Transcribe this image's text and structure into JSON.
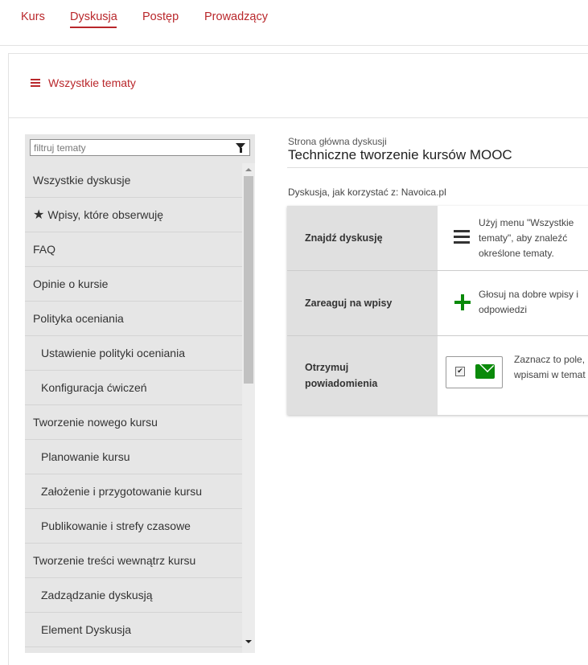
{
  "nav": {
    "tabs": [
      {
        "label": "Kurs"
      },
      {
        "label": "Dyskusja",
        "active": true
      },
      {
        "label": "Postęp"
      },
      {
        "label": "Prowadzący"
      }
    ]
  },
  "all_topics": {
    "label": "Wszystkie tematy",
    "icon": "menu-icon"
  },
  "sidebar": {
    "filter_placeholder": "filtruj tematy",
    "filter_icon": "filter-icon",
    "topics": [
      {
        "label": "Wszystkie dyskusje",
        "level": 0
      },
      {
        "label": "Wpisy, które obserwuję",
        "level": 0,
        "icon": "star-icon"
      },
      {
        "label": "FAQ",
        "level": 0
      },
      {
        "label": "Opinie o kursie",
        "level": 0
      },
      {
        "label": "Polityka oceniania",
        "level": 0
      },
      {
        "label": "Ustawienie polityki oceniania",
        "level": 1
      },
      {
        "label": "Konfiguracja ćwiczeń",
        "level": 1
      },
      {
        "label": "Tworzenie nowego kursu",
        "level": 0
      },
      {
        "label": "Planowanie kursu",
        "level": 1
      },
      {
        "label": "Założenie i przygotowanie kursu",
        "level": 1
      },
      {
        "label": "Publikowanie i strefy czasowe",
        "level": 1
      },
      {
        "label": "Tworzenie treści wewnątrz kursu",
        "level": 0
      },
      {
        "label": "Zadządzanie dyskusją",
        "level": 1
      },
      {
        "label": "Element Dyskusja",
        "level": 1
      }
    ]
  },
  "main": {
    "breadcrumb": "Strona główna dyskusji",
    "title": "Techniczne tworzenie kursów MOOC",
    "howto_prefix": "Dyskusja, jak korzystać z:",
    "howto_site": "Navoica.pl",
    "guide": [
      {
        "heading": "Znajdź dyskusję",
        "icon": "menu-icon",
        "text": [
          "Użyj menu \"Wszystkie",
          "tematy\", aby znaleźć",
          "określone tematy."
        ]
      },
      {
        "heading": "Zareaguj na wpisy",
        "icon": "plus-icon",
        "text": [
          "Głosuj na dobre wpisy i",
          "odpowiedzi"
        ]
      },
      {
        "heading": [
          "Otrzymuj",
          "powiadomienia"
        ],
        "icon": "envelope-icon",
        "text": [
          "Zaznacz to pole,",
          "wpisami w temat"
        ]
      }
    ]
  },
  "colors": {
    "accent": "#b9272b",
    "green": "#0a8a0a",
    "panel": "#e6e6e6"
  }
}
